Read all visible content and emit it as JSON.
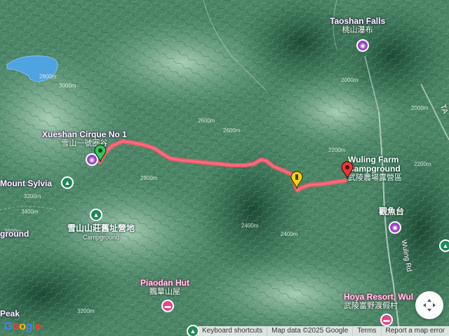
{
  "map": {
    "colors": {
      "route": "#ef5b6b",
      "start_marker": "#34c759",
      "mid_marker": "#f5d312",
      "end_marker": "#e53935",
      "lake": "#4fa3e0",
      "terrain_base": "#4f8a68"
    },
    "places": [
      {
        "id": "taoshan-falls",
        "en": "Taoshan Falls",
        "zh": "桃山瀑布",
        "icon": "camera-icon",
        "style": "purple"
      },
      {
        "id": "xueshan-cirque",
        "en": "Xueshan Cirque No 1",
        "zh": "雪山一號圈谷",
        "icon": "camera-icon",
        "style": "purple"
      },
      {
        "id": "wuling-farm",
        "en": "Wuling Farm Campground",
        "zh": "武陵農場露營區",
        "icon": "camp-icon",
        "style": "green"
      },
      {
        "id": "mount-sylvia",
        "en": "Mount Sylvia",
        "zh": "",
        "icon": "mountain-icon",
        "style": "green"
      },
      {
        "id": "xueshan-campground",
        "en": "雪山山莊舊址營地",
        "zh": "Campground",
        "icon": "camp-icon",
        "style": "green"
      },
      {
        "id": "left-campground",
        "en": "ground",
        "zh": "",
        "icon": "",
        "style": "green"
      },
      {
        "id": "guanyu",
        "en": "觀魚台",
        "zh": "",
        "icon": "camera-icon",
        "style": "purple"
      },
      {
        "id": "piaodan-hut",
        "en": "Piaodan Hut",
        "zh": "飄簞山屋",
        "icon": "bed-icon",
        "style": "pink"
      },
      {
        "id": "hoya-resort",
        "en": "Hoya Resort, Wul",
        "zh": "武陵富野渡假村",
        "icon": "bed-icon",
        "style": "pink"
      },
      {
        "id": "peak",
        "en": "Peak",
        "zh": "",
        "icon": "",
        "style": "green"
      }
    ],
    "road_labels": [
      "Wuling Rd",
      "TA"
    ],
    "elevation_labels": [
      "2800m",
      "3000m",
      "2600m",
      "2400m",
      "2200m",
      "2000m",
      "3200m",
      "3400m",
      "3600m",
      "2800m",
      "2600m",
      "2400m",
      "3200m",
      "2000m",
      "2200m"
    ]
  },
  "footer": {
    "google_logo": "Google",
    "keyboard_shortcuts": "Keyboard shortcuts",
    "map_data": "Map data ©2025 Google",
    "terms": "Terms",
    "report": "Report a map error"
  }
}
